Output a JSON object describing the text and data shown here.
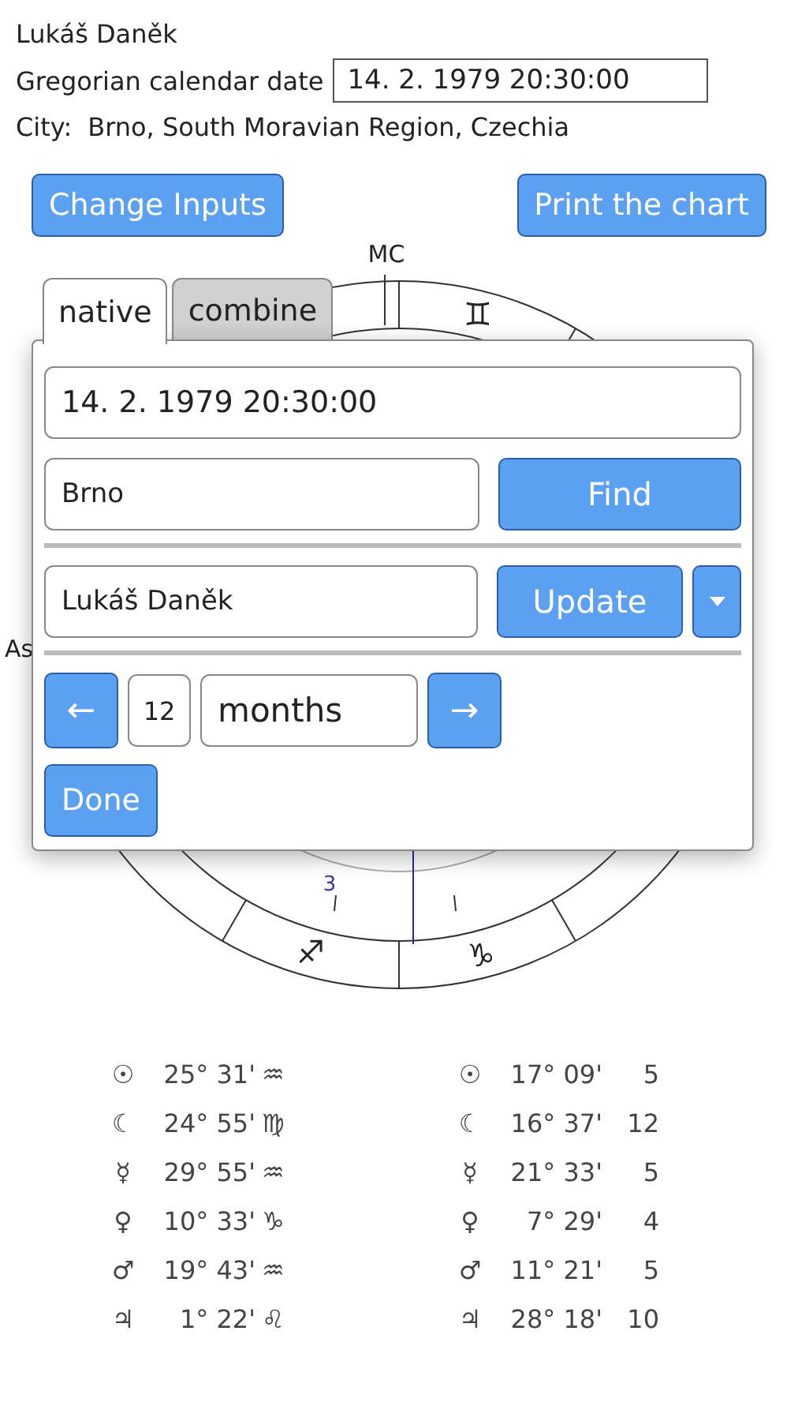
{
  "person": {
    "name": "Lukáš Daněk"
  },
  "date_field": {
    "label": "Gregorian calendar date",
    "value": "14. 2. 1979 20:30:00"
  },
  "city": {
    "label": "City:",
    "value": "Brno, South Moravian Region, Czechia"
  },
  "buttons": [
    "Change Inputs",
    "Print the chart"
  ],
  "chart": {
    "angle_labels": [
      "MC",
      "As"
    ],
    "sign_glyphs": [
      "♊",
      "♐",
      "♑"
    ],
    "house_numbers": [
      "3"
    ]
  },
  "tabs": [
    {
      "label": "native",
      "selected": true
    },
    {
      "label": "combine",
      "selected": false
    }
  ],
  "editor": {
    "date": "14. 2. 1979 20:30:00",
    "city": "Brno",
    "find": "Find",
    "name": "Lukáš Daněk",
    "update": "Update",
    "step_back": "←",
    "step_count": "12",
    "step_unit": "months",
    "step_forward": "→",
    "done": "Done"
  },
  "positions": {
    "natal": [
      {
        "planet": "☉",
        "position": "25° 31'",
        "sign": "♒"
      },
      {
        "planet": "☾",
        "position": "24° 55'",
        "sign": "♍"
      },
      {
        "planet": "☿",
        "position": "29° 55'",
        "sign": "♒"
      },
      {
        "planet": "♀",
        "position": "10° 33'",
        "sign": "♑"
      },
      {
        "planet": "♂",
        "position": "19° 43'",
        "sign": "♒"
      },
      {
        "planet": "♃",
        "position": "1° 22'",
        "sign": "♌"
      }
    ],
    "transit": [
      {
        "planet": "☉",
        "position": "17° 09'",
        "house": "5"
      },
      {
        "planet": "☾",
        "position": "16° 37'",
        "house": "12"
      },
      {
        "planet": "☿",
        "position": "21° 33'",
        "house": "5"
      },
      {
        "planet": "♀",
        "position": "7° 29'",
        "house": "4"
      },
      {
        "planet": "♂",
        "position": "11° 21'",
        "house": "5"
      },
      {
        "planet": "♃",
        "position": "28° 18'",
        "house": "10"
      }
    ]
  }
}
